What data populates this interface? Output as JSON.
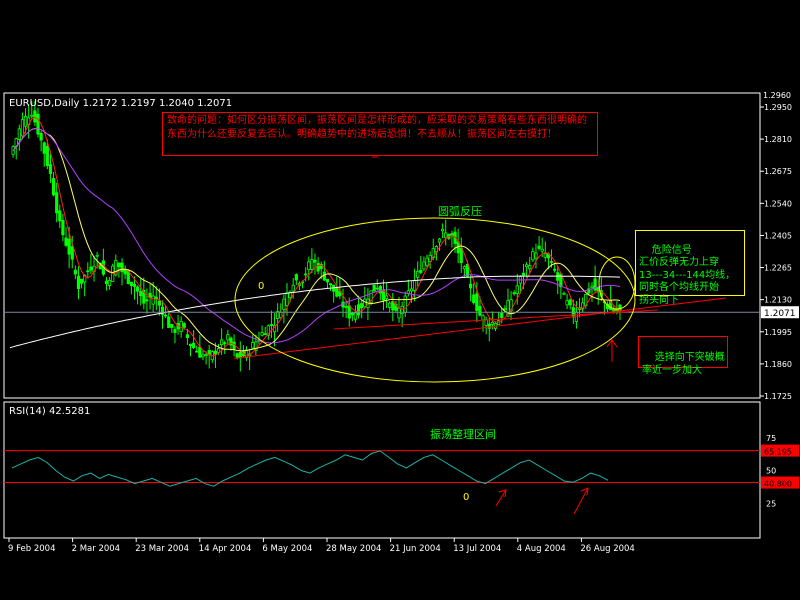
{
  "colors": {
    "background": "#000000",
    "panel_border": "#ffffff",
    "bull": "#00ff00",
    "bear": "#00ff00",
    "ma_fast": "#ff2020",
    "ma_mid": "#ffff66",
    "ma_slow": "#b040ff",
    "ma_long": "#ffffff",
    "rsi_line": "#20b2aa",
    "rsi_level": "#ff0000",
    "annotation_red": "#ff0000",
    "annotation_yellow": "#ffff00",
    "annotation_green": "#00ff00",
    "current_price_bg": "#ffffff",
    "current_price_fg": "#000000"
  },
  "main_panel": {
    "header": "EURUSD,Daily  1.2172 1.2197 1.2040 1.2071",
    "current_price": "1.2071",
    "top_stub": "1.2960",
    "price_labels": [
      "1.2950",
      "1.2810",
      "1.2675",
      "1.2540",
      "1.2405",
      "1.2265",
      "1.2130",
      "1.1995",
      "1.1860",
      "1.1725"
    ]
  },
  "rsi_panel": {
    "header": "RSI(14)  42.5281",
    "level_high": "65.195",
    "level_low": "40.800",
    "y_labels": [
      "100",
      "75",
      "50",
      "25",
      "0"
    ]
  },
  "x_labels": [
    "9 Feb 2004",
    "2 Mar 2004",
    "23 Mar 2004",
    "14 Apr 2004",
    "6 May 2004",
    "28 May 2004",
    "21 Jun 2004",
    "13 Jul 2004",
    "4 Aug 2004",
    "26 Aug 2004"
  ],
  "annotations": {
    "question_box": "致命的问题：如何区分振荡区间，振荡区间是怎样形成的，应采取的交易策略有些东西很明确的东西为什么还要反复去否认。明确趋势中的进场后恐惧！不去顺从！振荡区间左右摸打！",
    "arc_label": "圆弧反压",
    "danger_box": "危险信号\n汇价反弹无力上穿\n13---34---144均线，\n同时各个均线开始\n拐头向下",
    "breakout_box": "选择向下突破概\n率近一步加大",
    "range_label": "振荡整理区间",
    "zero_marker": "0",
    "zero_marker_rsi": "0"
  },
  "chart_data": [
    {
      "type": "candlestick",
      "title": "EURUSD,Daily",
      "ohlc_last": {
        "open": 1.2172,
        "high": 1.2197,
        "low": 1.204,
        "close": 1.2071
      },
      "x_ticks": [
        "9 Feb 2004",
        "2 Mar 2004",
        "23 Mar 2004",
        "14 Apr 2004",
        "6 May 2004",
        "28 May 2004",
        "21 Jun 2004",
        "13 Jul 2004",
        "4 Aug 2004",
        "26 Aug 2004"
      ],
      "ylim": [
        1.1725,
        1.296
      ],
      "close_path": [
        [
          0,
          1.272
        ],
        [
          4,
          1.286
        ],
        [
          7,
          1.29
        ],
        [
          10,
          1.278
        ],
        [
          13,
          1.264
        ],
        [
          16,
          1.243
        ],
        [
          19,
          1.232
        ],
        [
          22,
          1.218
        ],
        [
          25,
          1.224
        ],
        [
          28,
          1.23
        ],
        [
          31,
          1.219
        ],
        [
          34,
          1.228
        ],
        [
          37,
          1.222
        ],
        [
          40,
          1.218
        ],
        [
          43,
          1.211
        ],
        [
          46,
          1.214
        ],
        [
          49,
          1.208
        ],
        [
          52,
          1.199
        ],
        [
          55,
          1.202
        ],
        [
          58,
          1.194
        ],
        [
          61,
          1.19
        ],
        [
          64,
          1.188
        ],
        [
          67,
          1.193
        ],
        [
          70,
          1.196
        ],
        [
          73,
          1.188
        ],
        [
          76,
          1.19
        ],
        [
          79,
          1.195
        ],
        [
          82,
          1.2
        ],
        [
          85,
          1.203
        ],
        [
          88,
          1.212
        ],
        [
          91,
          1.22
        ],
        [
          94,
          1.221
        ],
        [
          97,
          1.229
        ],
        [
          100,
          1.224
        ],
        [
          103,
          1.218
        ],
        [
          106,
          1.212
        ],
        [
          109,
          1.206
        ],
        [
          112,
          1.208
        ],
        [
          115,
          1.214
        ],
        [
          118,
          1.218
        ],
        [
          121,
          1.212
        ],
        [
          124,
          1.206
        ],
        [
          127,
          1.212
        ],
        [
          130,
          1.22
        ],
        [
          133,
          1.228
        ],
        [
          136,
          1.234
        ],
        [
          139,
          1.24
        ],
        [
          142,
          1.238
        ],
        [
          145,
          1.228
        ],
        [
          148,
          1.216
        ],
        [
          151,
          1.206
        ],
        [
          154,
          1.202
        ],
        [
          157,
          1.204
        ],
        [
          160,
          1.21
        ],
        [
          163,
          1.218
        ],
        [
          166,
          1.226
        ],
        [
          169,
          1.233
        ],
        [
          172,
          1.231
        ],
        [
          175,
          1.224
        ],
        [
          178,
          1.213
        ],
        [
          181,
          1.206
        ],
        [
          184,
          1.212
        ],
        [
          187,
          1.218
        ],
        [
          190,
          1.213
        ],
        [
          193,
          1.208
        ],
        [
          196,
          1.2071
        ]
      ],
      "moving_averages": [
        "13",
        "34",
        "144"
      ],
      "support_line": {
        "from": [
          72,
          1.188
        ],
        "to": [
          230,
          1.213
        ]
      },
      "current_price": 1.2071
    },
    {
      "type": "line",
      "title": "RSI(14)",
      "latest": 42.5281,
      "levels": [
        65.195,
        40.8
      ],
      "ylim": [
        0,
        100
      ],
      "y_ticks": [
        100,
        75,
        50,
        25,
        0
      ],
      "values": [
        52,
        55,
        58,
        60,
        56,
        50,
        45,
        42,
        46,
        48,
        44,
        47,
        45,
        43,
        40,
        42,
        44,
        41,
        38,
        40,
        42,
        44,
        40,
        38,
        42,
        45,
        48,
        52,
        55,
        58,
        60,
        57,
        54,
        50,
        48,
        52,
        55,
        58,
        62,
        60,
        58,
        63,
        65,
        60,
        55,
        52,
        56,
        60,
        62,
        58,
        54,
        50,
        46,
        42,
        40,
        44,
        48,
        52,
        56,
        58,
        54,
        50,
        46,
        42,
        41,
        44,
        48,
        46,
        42.5
      ]
    }
  ]
}
